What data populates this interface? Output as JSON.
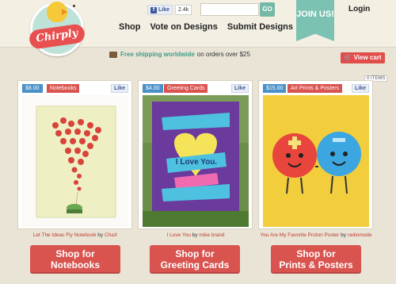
{
  "brand": {
    "logo_text": "Chirply"
  },
  "header": {
    "fb_like_label": "Like",
    "fb_like_count": "2.4k",
    "search_placeholder": "",
    "search_button": "GO",
    "join_label": "JOIN US!",
    "login_label": "Login"
  },
  "nav": {
    "items": [
      {
        "label": "Shop"
      },
      {
        "label": "Vote on Designs"
      },
      {
        "label": "Submit Designs"
      }
    ]
  },
  "promo": {
    "highlight": "Free shipping worldwide",
    "rest": "on orders over $25"
  },
  "cart": {
    "view_cart_label": "View cart",
    "items_label": "0 ITEMS"
  },
  "products": [
    {
      "price": "$8.00",
      "category": "Notebooks",
      "like": "Like",
      "title": "Let The Ideas Fly Notebook",
      "by": "by",
      "author": "ChaX",
      "shop_line1": "Shop for",
      "shop_line2": "Notebooks"
    },
    {
      "price": "$4.00",
      "category": "Greeting Cards",
      "like": "Like",
      "title": "I Love You",
      "by": "by",
      "author": "mike brand",
      "card_text": "I Love You.",
      "shop_line1": "Shop for",
      "shop_line2": "Greeting Cards"
    },
    {
      "price": "$15.00",
      "category": "Art Prints & Posters",
      "like": "Like",
      "title": "You Are My Favorite Proton Poster",
      "by": "by",
      "author": "radiomode",
      "shop_line1": "Shop for",
      "shop_line2": "Prints & Posters"
    }
  ],
  "colors": {
    "accent_red": "#d9534f",
    "accent_teal": "#7cc2b2",
    "price_blue": "#4a90c8",
    "background": "#e9e4d6"
  }
}
